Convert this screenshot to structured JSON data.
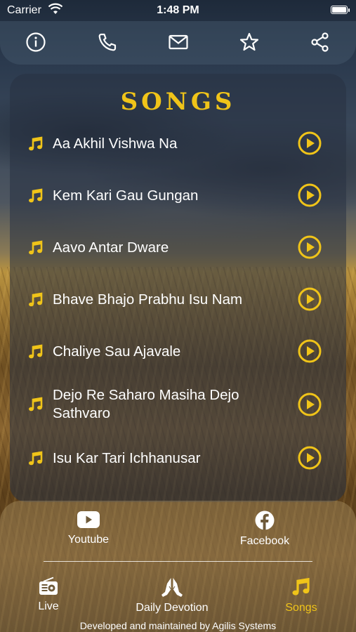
{
  "status_bar": {
    "carrier": "Carrier",
    "time": "1:48 PM"
  },
  "toolbar": {
    "icons": [
      "info-icon",
      "phone-icon",
      "mail-icon",
      "star-icon",
      "share-icon"
    ]
  },
  "songs": {
    "title": "SONGS",
    "items": [
      "Aa Akhil Vishwa Na",
      "Kem Kari Gau Gungan",
      "Aavo Antar Dware",
      "Bhave Bhajo Prabhu Isu Nam",
      "Chaliye Sau Ajavale",
      "Dejo Re Saharo Masiha Dejo Sathvaro",
      "Isu Kar Tari Ichhanusar"
    ]
  },
  "social": {
    "youtube": "Youtube",
    "facebook": "Facebook"
  },
  "tabs": {
    "live": "Live",
    "daily_devotion": "Daily Devotion",
    "songs": "Songs"
  },
  "footer": "Developed and maintained by Agilis Systems",
  "colors": {
    "accent": "#f0c419",
    "text": "#ffffff"
  }
}
